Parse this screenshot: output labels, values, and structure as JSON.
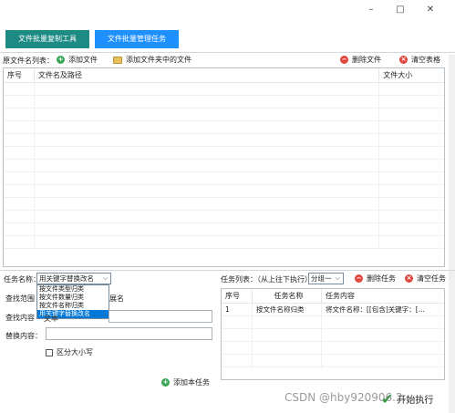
{
  "window": {
    "minimize": "–",
    "maximize": "□",
    "close": "✕"
  },
  "tabs": [
    {
      "label": "文件批量复制工具",
      "color": "#1e8a84"
    },
    {
      "label": "文件批量管理任务",
      "color": "#1e90ff"
    }
  ],
  "source": {
    "label": "原文件名列表：",
    "add_file": "添加文件",
    "add_folder_files": "添加文件夹中的文件",
    "delete_file": "删除文件",
    "clear_table": "清空表格",
    "columns": [
      "序号",
      "文件名及路径",
      "文件大小"
    ]
  },
  "task": {
    "name_label": "任务名称：",
    "selected": "用关键字替换改名",
    "options": [
      "按文件类型归类",
      "按文件数量归类",
      "按文件名称归类",
      "用关键字替换改名"
    ],
    "scope_label": "查找范围",
    "scope_suffix": "展名",
    "find_label": "查找内容",
    "find_value": "文本",
    "replace_label": "替换内容：",
    "case_label": "区分大小写",
    "add_task": "添加本任务"
  },
  "task_list": {
    "label": "任务列表：（从上往下执行）",
    "group": "分组一",
    "delete_task": "删除任务",
    "clear_task": "清空任务",
    "columns": [
      "序号",
      "任务名称",
      "任务内容"
    ],
    "rows": [
      {
        "no": "1",
        "name": "按文件名称归类",
        "content": "将文件名称：[[包含]关键字：[..."
      }
    ]
  },
  "bottom": {
    "start": "开始执行"
  },
  "watermark": "CSDN @hby920906.2..."
}
